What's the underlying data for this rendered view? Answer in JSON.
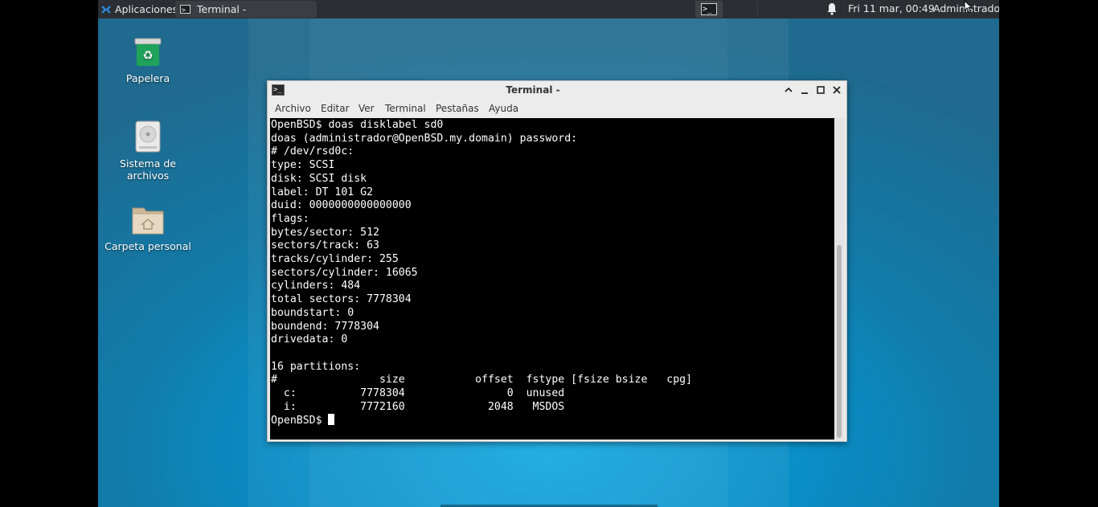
{
  "panel": {
    "apps_label": "Aplicaciones",
    "task_title": "Terminal -",
    "clock": "Fri 11 mar, 00:49",
    "user": "Administrador",
    "icons": {
      "apps": "xfce-mouse-icon",
      "task": "terminal-icon",
      "workspace": "terminal-icon",
      "notifications": "bell-icon"
    }
  },
  "desktop": {
    "icons": [
      {
        "label": "Papelera",
        "icon": "trash-icon"
      },
      {
        "label": "Sistema de archivos",
        "icon": "drive-icon"
      },
      {
        "label": "Carpeta personal",
        "icon": "home-folder-icon"
      }
    ]
  },
  "window": {
    "title": "Terminal -",
    "menu": [
      "Archivo",
      "Editar",
      "Ver",
      "Terminal",
      "Pestañas",
      "Ayuda"
    ],
    "buttons": [
      "minimize-up",
      "minimize",
      "maximize",
      "close"
    ],
    "terminal_lines": [
      "OpenBSD$ doas disklabel sd0",
      "doas (administrador@OpenBSD.my.domain) password:",
      "# /dev/rsd0c:",
      "type: SCSI",
      "disk: SCSI disk",
      "label: DT 101 G2",
      "duid: 0000000000000000",
      "flags:",
      "bytes/sector: 512",
      "sectors/track: 63",
      "tracks/cylinder: 255",
      "sectors/cylinder: 16065",
      "cylinders: 484",
      "total sectors: 7778304",
      "boundstart: 0",
      "boundend: 7778304",
      "drivedata: 0",
      "",
      "16 partitions:",
      "#                size           offset  fstype [fsize bsize   cpg]",
      "  c:          7778304                0  unused",
      "  i:          7772160             2048   MSDOS"
    ],
    "prompt": "OpenBSD$ "
  },
  "colors": {
    "panel_bg": "#2b2f33",
    "desktop_blue": "#0a8cc4",
    "terminal_bg": "#000000",
    "terminal_fg": "#ffffff"
  }
}
